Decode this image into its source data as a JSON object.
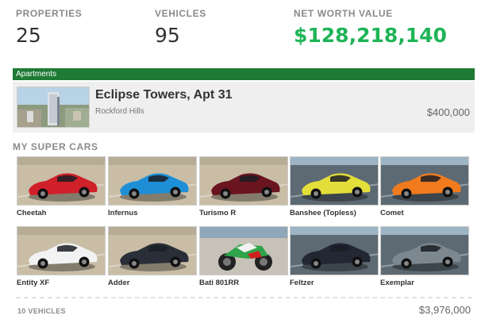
{
  "stats": {
    "properties_label": "PROPERTIES",
    "properties_value": "25",
    "vehicles_label": "VEHICLES",
    "vehicles_value": "95",
    "networth_label": "NET WORTH VALUE",
    "networth_value": "$128,218,140"
  },
  "apartments": {
    "header": "Apartments",
    "name": "Eclipse Towers, Apt 31",
    "area": "Rockford Hills",
    "price": "$400,000"
  },
  "cars_section": {
    "title": "MY SUPER CARS",
    "cars": [
      {
        "name": "Cheetah",
        "color": "#d0202a"
      },
      {
        "name": "Infernus",
        "color": "#1e8fd6"
      },
      {
        "name": "Turismo R",
        "color": "#6a1420"
      },
      {
        "name": "Banshee (Topless)",
        "color": "#e3de3a"
      },
      {
        "name": "Comet",
        "color": "#f07b1e"
      },
      {
        "name": "Entity XF",
        "color": "#f2f2f2"
      },
      {
        "name": "Adder",
        "color": "#2a2e38"
      },
      {
        "name": "Bati 801RR",
        "color": "#2fa44a"
      },
      {
        "name": "Feltzer",
        "color": "#232733"
      },
      {
        "name": "Exemplar",
        "color": "#7d8790"
      }
    ],
    "total_label": "10 VEHICLES",
    "total_value": "$3,976,000"
  }
}
